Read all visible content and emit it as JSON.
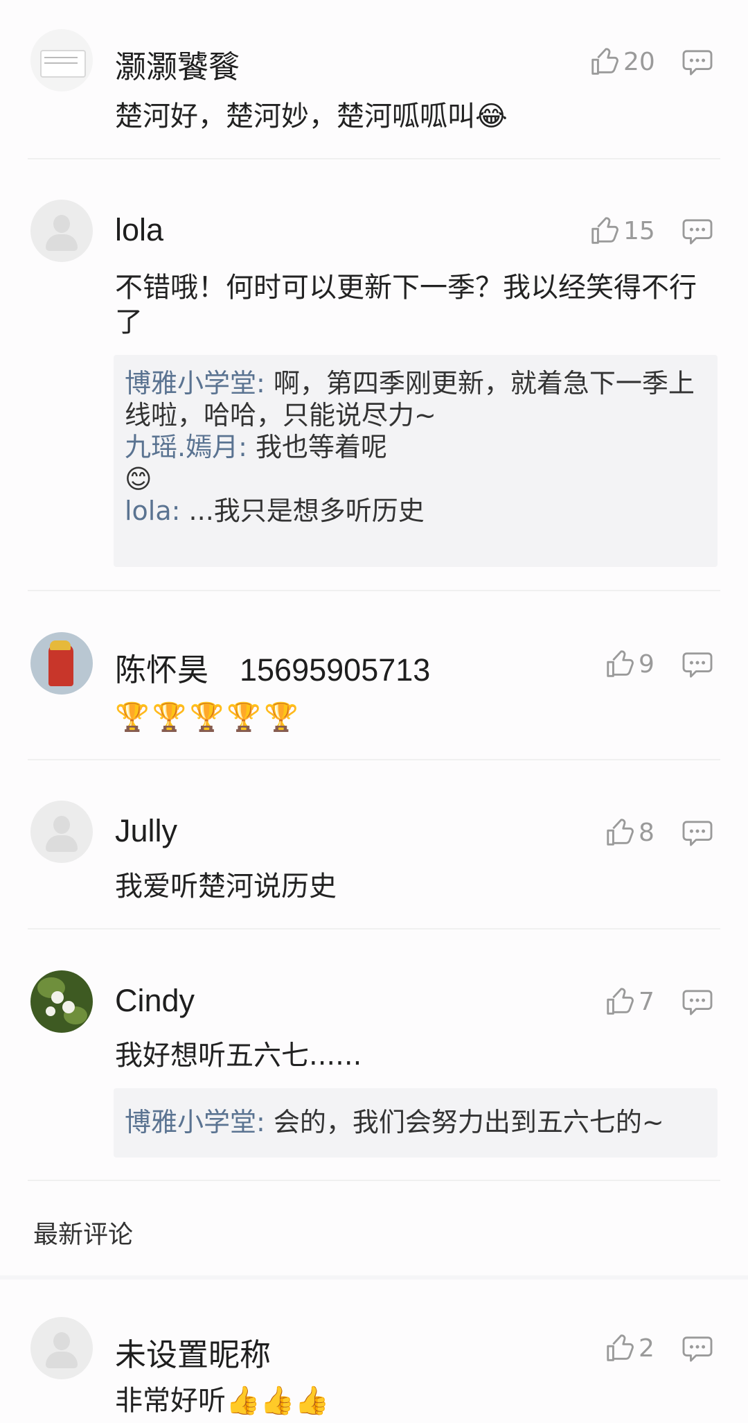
{
  "comments": [
    {
      "name": "灏灏饕餮",
      "likes": "20",
      "text": "楚河好，楚河妙，楚河呱呱叫😂",
      "avatar": "book-avatar"
    },
    {
      "name": "lola",
      "likes": "15",
      "text": "不错哦！何时可以更新下一季？我以经笑得不行了",
      "avatar": "default-avatar",
      "replies": [
        {
          "who": "博雅小学堂:",
          "text": " 啊，第四季刚更新，就着急下一季上线啦，哈哈，只能说尽力~"
        },
        {
          "who": "九瑶.嫣月:",
          "text": " 我也等着呢"
        },
        {
          "who": "",
          "text": "😊"
        },
        {
          "who": "lola:",
          "text": " ...我只是想多听历史"
        }
      ]
    },
    {
      "name": "陈怀昊　15695905713",
      "likes": "9",
      "text": "🏆🏆🏆🏆🏆",
      "avatar": "photo-avatar"
    },
    {
      "name": "Jully",
      "likes": "8",
      "text": "我爱听楚河说历史",
      "avatar": "default-avatar"
    },
    {
      "name": "Cindy",
      "likes": "7",
      "text": "我好想听五六七......",
      "avatar": "flower-avatar",
      "replies": [
        {
          "who": "博雅小学堂:",
          "text": " 会的，我们会努力出到五六七的~"
        }
      ]
    }
  ],
  "latest_section_label": "最新评论",
  "latest_comments": [
    {
      "name": "未设置昵称",
      "likes": "2",
      "text": "非常好听👍👍👍",
      "avatar": "default-avatar"
    }
  ],
  "colors": {
    "reply_name": "#5a7391",
    "icon_gray": "#9a9a9a",
    "reply_bg": "#f3f3f5"
  },
  "icons": [
    "thumbs-up-icon",
    "comment-icon"
  ]
}
